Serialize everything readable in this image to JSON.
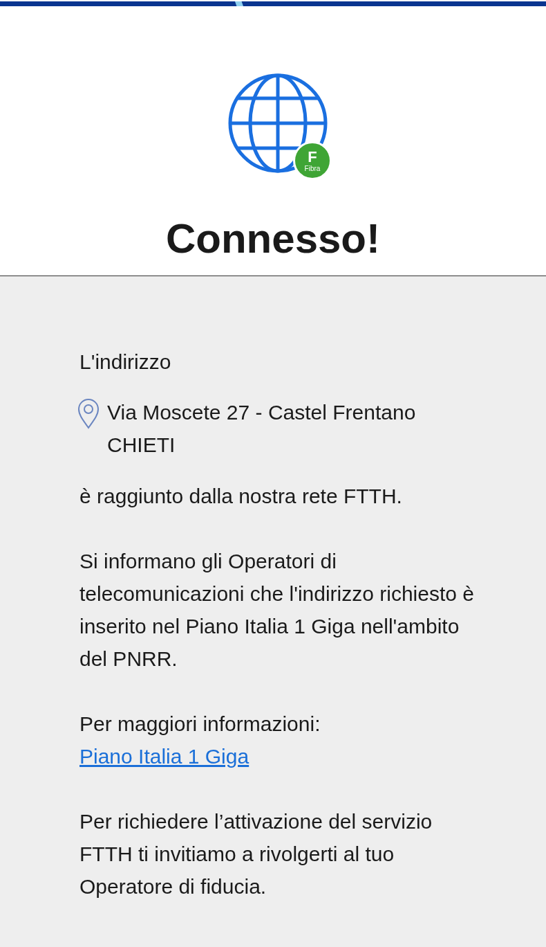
{
  "badge": {
    "letter": "F",
    "label": "Fibra"
  },
  "title": "Connesso!",
  "intro": "L'indirizzo",
  "address_lines": [
    "Via Moscete 27 - Castel Frentano",
    "CHIETI"
  ],
  "reached": "è raggiunto dalla nostra rete FTTH.",
  "notice": "Si informano gli Operatori di telecomunicazioni che l'indirizzo richiesto è inserito nel Piano Italia 1 Giga nell'ambito del PNRR.",
  "more_info": {
    "label": "Per maggiori informazioni:",
    "link": "Piano Italia 1 Giga"
  },
  "activation": "Per richiedere l’attivazione del servizio FTTH ti invitiamo a rivolgerti al tuo Operatore di fiducia."
}
